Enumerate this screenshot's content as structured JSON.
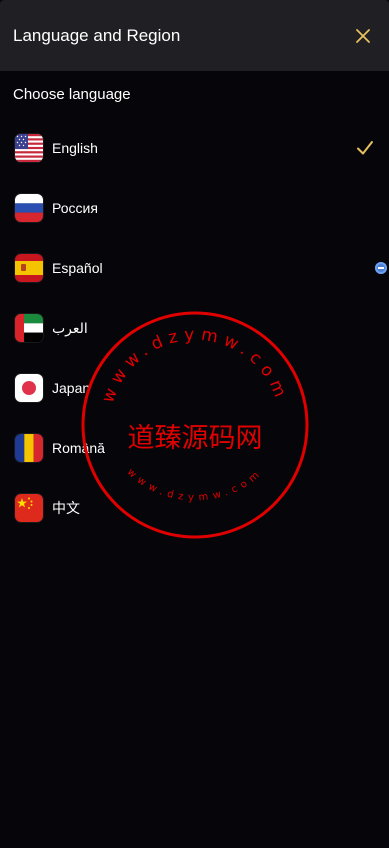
{
  "header": {
    "title": "Language and Region",
    "close_icon": "close-icon"
  },
  "section_label": "Choose language",
  "colors": {
    "accent": "#e8c060",
    "header_bg": "#1f1f24",
    "page_bg": "#05050a",
    "watermark": "#e00000"
  },
  "languages": [
    {
      "label": "English",
      "flag": "us-flag-icon",
      "selected": true
    },
    {
      "label": "Россия",
      "flag": "russia-flag-icon",
      "selected": false
    },
    {
      "label": "Español",
      "flag": "spain-flag-icon",
      "selected": false
    },
    {
      "label": "العرب",
      "flag": "uae-flag-icon",
      "selected": false
    },
    {
      "label": "Japan",
      "flag": "japan-flag-icon",
      "selected": false
    },
    {
      "label": "Română",
      "flag": "romania-flag-icon",
      "selected": false
    },
    {
      "label": "中文",
      "flag": "china-flag-icon",
      "selected": false
    }
  ],
  "watermark": {
    "center_text": "道臻源码网",
    "outer_text": "www.dzymw.com",
    "inner_text": "www.dzymw.com"
  }
}
